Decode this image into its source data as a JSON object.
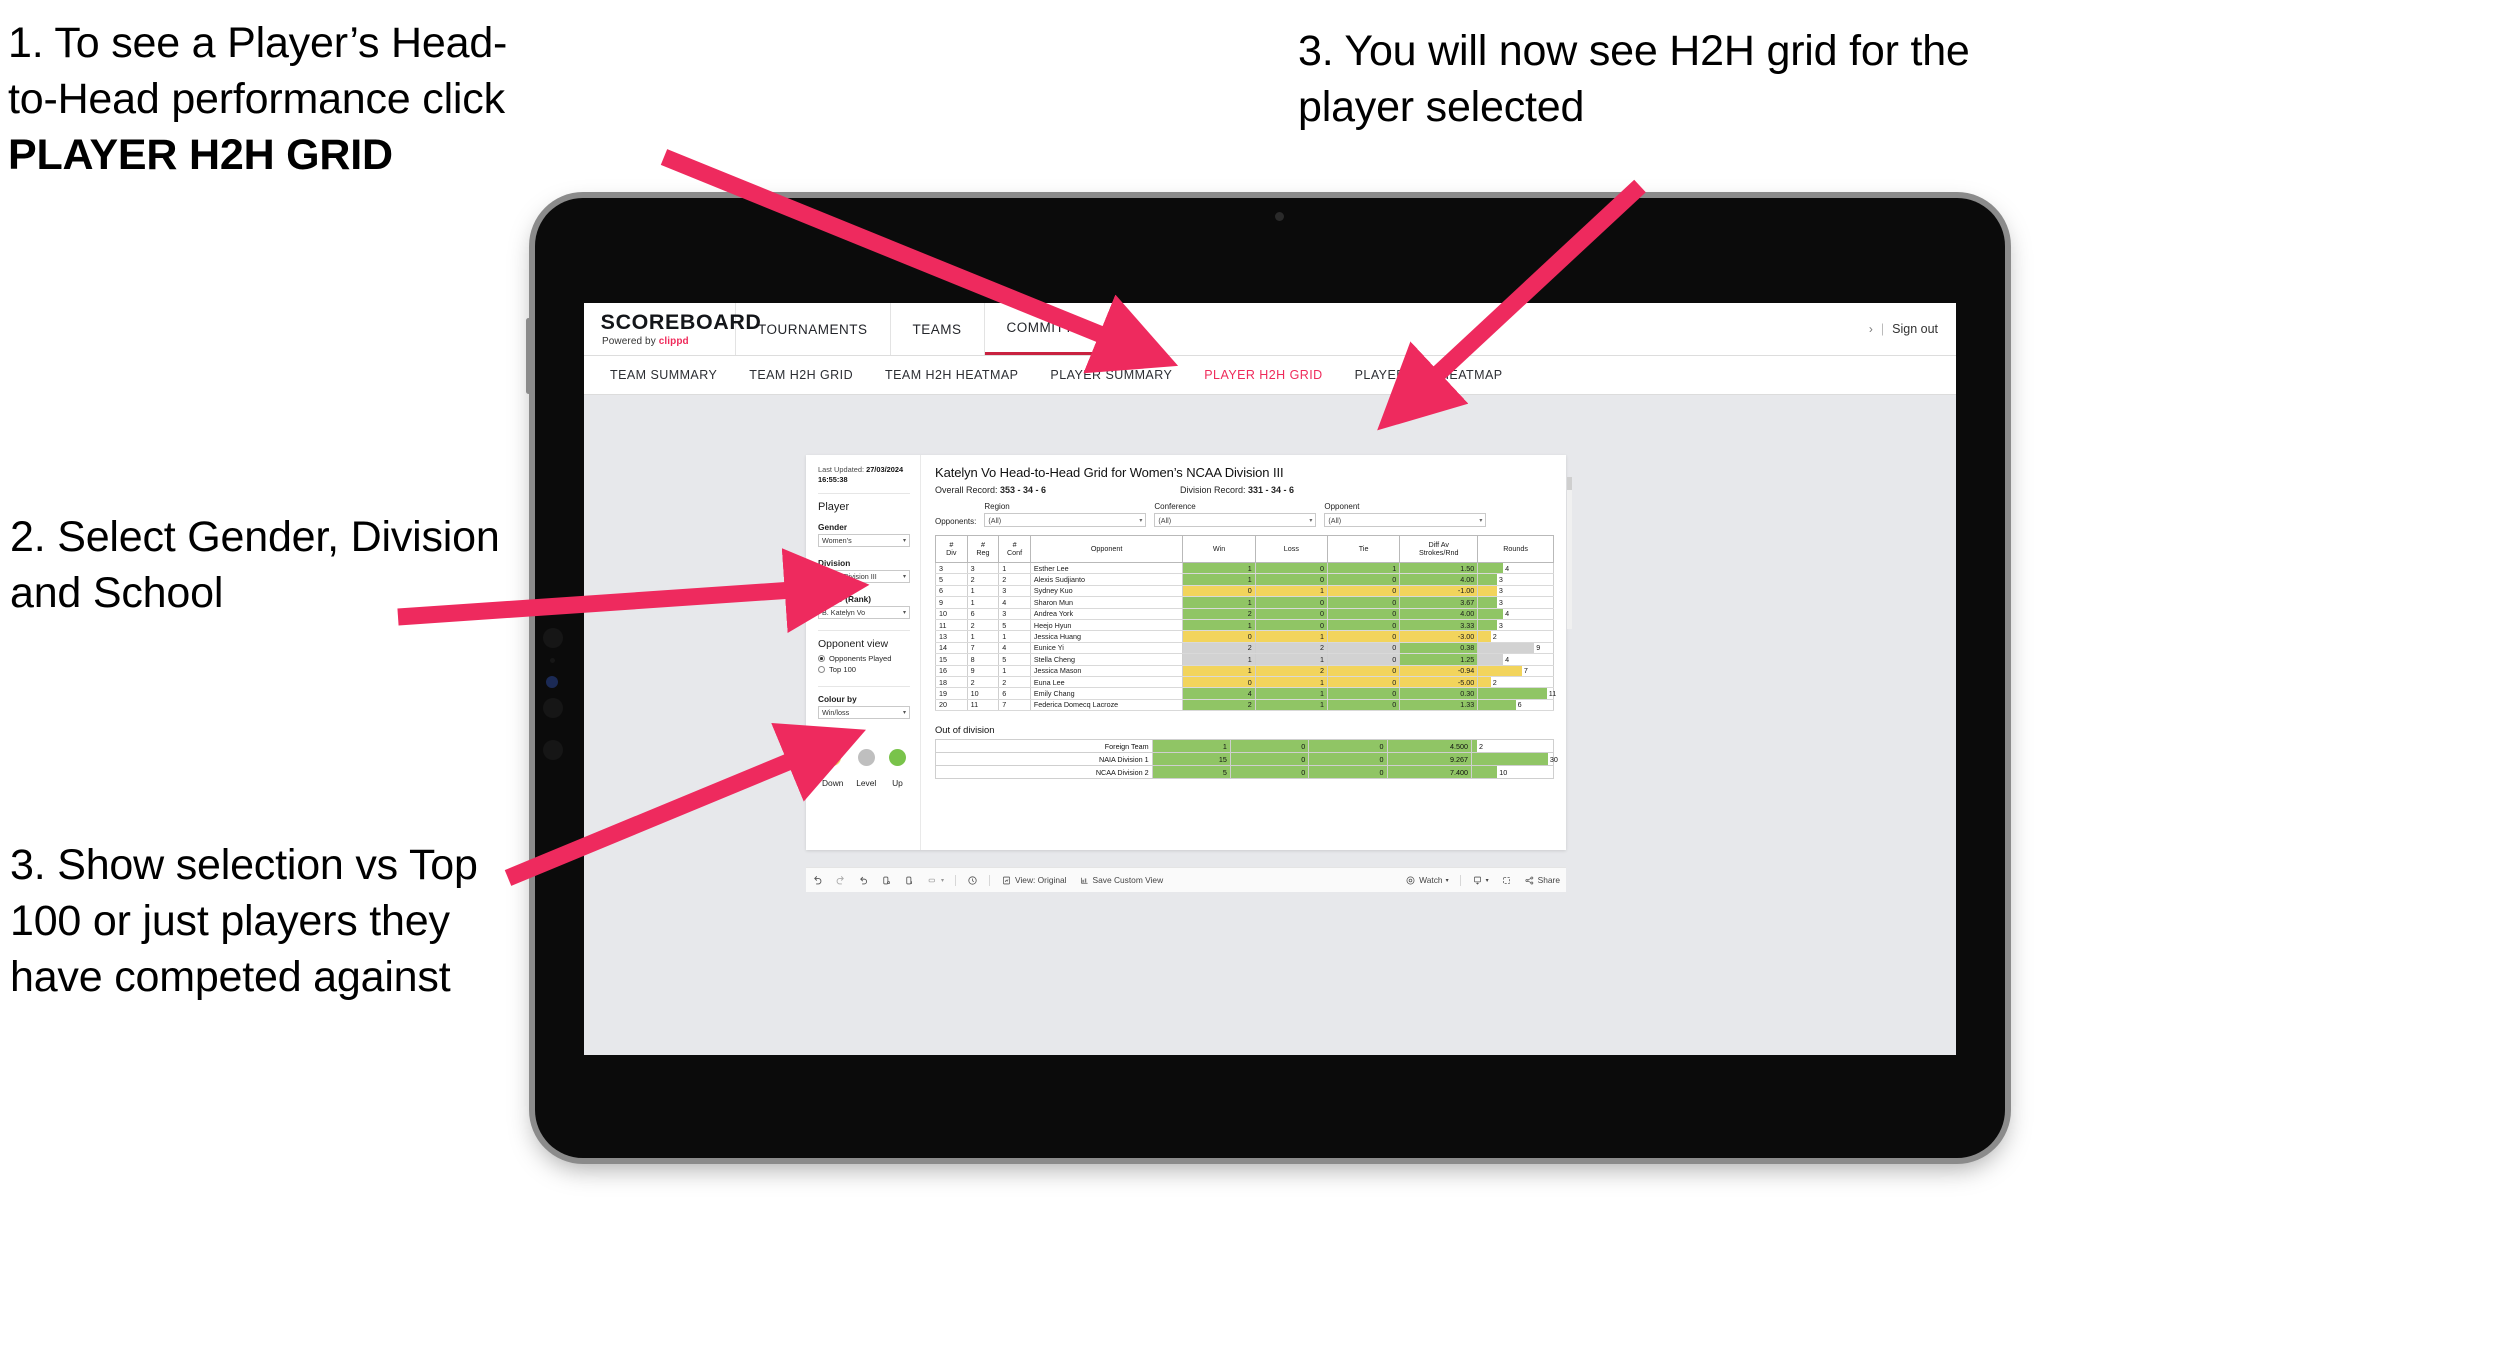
{
  "annotations": {
    "one_line1": "1. To see a Player’s Head-",
    "one_line2": "to-Head performance click",
    "one_bold": "PLAYER H2H GRID",
    "two": "2. Select Gender, Division and School",
    "three_left": "3. Show selection vs Top 100 or just players they have competed against",
    "three_right": "3. You will now see H2H grid for the player selected",
    "arrow_color": "#ee2a5e"
  },
  "app": {
    "brand_word": "SCOREBOARD",
    "brand_sub_prefix": "Powered by ",
    "brand_sub_accent": "clippd",
    "nav": [
      {
        "label": "TOURNAMENTS",
        "active": false
      },
      {
        "label": "TEAMS",
        "active": false
      },
      {
        "label": "COMMITTEE",
        "active": true
      }
    ],
    "sign_out": "Sign out",
    "chevron": "›",
    "divider": "|",
    "subtabs": [
      {
        "label": "TEAM SUMMARY",
        "active": false
      },
      {
        "label": "TEAM H2H GRID",
        "active": false
      },
      {
        "label": "TEAM H2H HEATMAP",
        "active": false
      },
      {
        "label": "PLAYER SUMMARY",
        "active": false
      },
      {
        "label": "PLAYER H2H GRID",
        "active": true
      },
      {
        "label": "PLAYER H2H HEATMAP",
        "active": false
      }
    ],
    "accent": "#ef2b5b"
  },
  "filters": {
    "last_updated_label": "Last Updated: ",
    "last_updated_date": "27/03/2024",
    "last_updated_time": "16:55:38",
    "player_group": "Player",
    "gender_label": "Gender",
    "gender_value": "Women’s",
    "division_label": "Division",
    "division_value": "NCAA Division III",
    "player_label": "Player (Rank)",
    "player_value": "B. Katelyn Vo",
    "opponent_view_title": "Opponent view",
    "radio_played": "Opponents Played",
    "radio_top100": "Top 100",
    "colour_by_label": "Colour by",
    "colour_by_value": "Win/loss",
    "legend": [
      {
        "label": "Down",
        "color": "#f2d45c"
      },
      {
        "label": "Level",
        "color": "#bfbfbf"
      },
      {
        "label": "Up",
        "color": "#79c34a"
      }
    ],
    "caret": "▾"
  },
  "viz": {
    "title": "Katelyn Vo Head-to-Head Grid for Women’s NCAA Division III",
    "overall_label": "Overall Record: ",
    "overall_value": "353 - 34 - 6",
    "division_label": "Division Record: ",
    "division_value": "331 - 34 - 6",
    "opponents_label": "Opponents:",
    "opponent_filters": [
      {
        "title": "Region",
        "value": "(All)"
      },
      {
        "title": "Conference",
        "value": "(All)"
      },
      {
        "title": "Opponent",
        "value": "(All)"
      }
    ],
    "out_of_division_title": "Out of division"
  },
  "chart_data": {
    "type": "table",
    "title": "Katelyn Vo Head-to-Head Grid for Women’s NCAA Division III",
    "columns": [
      "# Div",
      "# Reg",
      "# Conf",
      "Opponent",
      "Win",
      "Loss",
      "Tie",
      "Diff Av Strokes/Rnd",
      "Rounds"
    ],
    "header_lines": [
      [
        "#",
        "Div"
      ],
      [
        "#",
        "Reg"
      ],
      [
        "#",
        "Conf"
      ],
      [
        "Opponent",
        ""
      ],
      [
        "Win",
        ""
      ],
      [
        "Loss",
        ""
      ],
      [
        "Tie",
        ""
      ],
      [
        "Diff Av",
        "Strokes/Rnd"
      ],
      [
        "Rounds",
        ""
      ]
    ],
    "rounds_max": 12,
    "rows": [
      {
        "div": "3",
        "reg": "3",
        "conf": "1",
        "opponent": "Esther Lee",
        "win": "1",
        "loss": "0",
        "tie": "1",
        "diff": "1.50",
        "rounds": "4",
        "state": "up"
      },
      {
        "div": "5",
        "reg": "2",
        "conf": "2",
        "opponent": "Alexis Sudjianto",
        "win": "1",
        "loss": "0",
        "tie": "0",
        "diff": "4.00",
        "rounds": "3",
        "state": "up"
      },
      {
        "div": "6",
        "reg": "1",
        "conf": "3",
        "opponent": "Sydney Kuo",
        "win": "0",
        "loss": "1",
        "tie": "0",
        "diff": "-1.00",
        "rounds": "3",
        "state": "down"
      },
      {
        "div": "9",
        "reg": "1",
        "conf": "4",
        "opponent": "Sharon Mun",
        "win": "1",
        "loss": "0",
        "tie": "0",
        "diff": "3.67",
        "rounds": "3",
        "state": "up"
      },
      {
        "div": "10",
        "reg": "6",
        "conf": "3",
        "opponent": "Andrea York",
        "win": "2",
        "loss": "0",
        "tie": "0",
        "diff": "4.00",
        "rounds": "4",
        "state": "up"
      },
      {
        "div": "11",
        "reg": "2",
        "conf": "5",
        "opponent": "Heejo Hyun",
        "win": "1",
        "loss": "0",
        "tie": "0",
        "diff": "3.33",
        "rounds": "3",
        "state": "up"
      },
      {
        "div": "13",
        "reg": "1",
        "conf": "1",
        "opponent": "Jessica Huang",
        "win": "0",
        "loss": "1",
        "tie": "0",
        "diff": "-3.00",
        "rounds": "2",
        "state": "down"
      },
      {
        "div": "14",
        "reg": "7",
        "conf": "4",
        "opponent": "Eunice Yi",
        "win": "2",
        "loss": "2",
        "tie": "0",
        "diff": "0.38",
        "rounds": "9",
        "state": "level",
        "diff_state": "up"
      },
      {
        "div": "15",
        "reg": "8",
        "conf": "5",
        "opponent": "Stella Cheng",
        "win": "1",
        "loss": "1",
        "tie": "0",
        "diff": "1.25",
        "rounds": "4",
        "state": "level",
        "diff_state": "up"
      },
      {
        "div": "16",
        "reg": "9",
        "conf": "1",
        "opponent": "Jessica Mason",
        "win": "1",
        "loss": "2",
        "tie": "0",
        "diff": "-0.94",
        "rounds": "7",
        "state": "down"
      },
      {
        "div": "18",
        "reg": "2",
        "conf": "2",
        "opponent": "Euna Lee",
        "win": "0",
        "loss": "1",
        "tie": "0",
        "diff": "-5.00",
        "rounds": "2",
        "state": "down"
      },
      {
        "div": "19",
        "reg": "10",
        "conf": "6",
        "opponent": "Emily Chang",
        "win": "4",
        "loss": "1",
        "tie": "0",
        "diff": "0.30",
        "rounds": "11",
        "state": "up"
      },
      {
        "div": "20",
        "reg": "11",
        "conf": "7",
        "opponent": "Federica Domecq Lacroze",
        "win": "2",
        "loss": "1",
        "tie": "0",
        "diff": "1.33",
        "rounds": "6",
        "state": "up"
      }
    ],
    "out_of_division": {
      "rounds_max": 32,
      "rows": [
        {
          "name": "Foreign Team",
          "win": "1",
          "loss": "0",
          "tie": "0",
          "diff": "4.500",
          "rounds": "2",
          "state": "up"
        },
        {
          "name": "NAIA Division 1",
          "win": "15",
          "loss": "0",
          "tie": "0",
          "diff": "9.267",
          "rounds": "30",
          "state": "up"
        },
        {
          "name": "NCAA Division 2",
          "win": "5",
          "loss": "0",
          "tie": "0",
          "diff": "7.400",
          "rounds": "10",
          "state": "up"
        }
      ]
    }
  },
  "toolbar": {
    "view_label": "View: Original",
    "save_label": "Save Custom View",
    "watch_label": "Watch",
    "share_label": "Share",
    "caret": "▾"
  }
}
